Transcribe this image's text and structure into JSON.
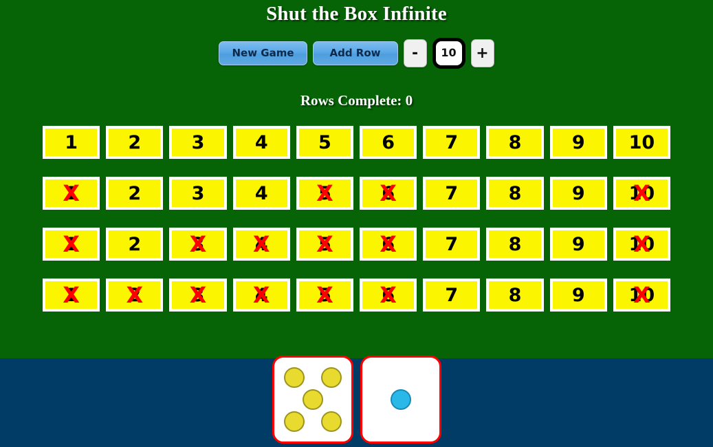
{
  "colors": {
    "board_green": "#066406",
    "tray_navy": "#003c66",
    "tile_yellow": "#fcf500",
    "tile_border": "#ffffff",
    "cross_red": "#ff0000",
    "button_blue": "#5aa8e8",
    "die_border_red": "#ff0000",
    "pip_yellow": "#e8da2e",
    "pip_cyan": "#2ab8e8"
  },
  "header": {
    "title": "Shut the Box Infinite"
  },
  "controls": {
    "new_game_label": "New Game",
    "add_row_label": "Add Row",
    "decrement_label": "-",
    "increment_label": "+",
    "row_count_value": "10"
  },
  "status": {
    "rows_complete_text": "Rows Complete: 0",
    "rows_complete_count": 0
  },
  "board": {
    "cross_glyph": "X",
    "columns": 10,
    "rows": [
      {
        "index": 1,
        "tiles": [
          {
            "label": "1",
            "open": true
          },
          {
            "label": "2",
            "open": true
          },
          {
            "label": "3",
            "open": true
          },
          {
            "label": "4",
            "open": true
          },
          {
            "label": "5",
            "open": true
          },
          {
            "label": "6",
            "open": true
          },
          {
            "label": "7",
            "open": true
          },
          {
            "label": "8",
            "open": true
          },
          {
            "label": "9",
            "open": true
          },
          {
            "label": "10",
            "open": true
          }
        ]
      },
      {
        "index": 2,
        "tiles": [
          {
            "label": "1",
            "open": false
          },
          {
            "label": "2",
            "open": true
          },
          {
            "label": "3",
            "open": true
          },
          {
            "label": "4",
            "open": true
          },
          {
            "label": "5",
            "open": false
          },
          {
            "label": "6",
            "open": false
          },
          {
            "label": "7",
            "open": true
          },
          {
            "label": "8",
            "open": true
          },
          {
            "label": "9",
            "open": true
          },
          {
            "label": "10",
            "open": false
          }
        ]
      },
      {
        "index": 3,
        "tiles": [
          {
            "label": "1",
            "open": false
          },
          {
            "label": "2",
            "open": true
          },
          {
            "label": "3",
            "open": false
          },
          {
            "label": "4",
            "open": false
          },
          {
            "label": "5",
            "open": false
          },
          {
            "label": "6",
            "open": false
          },
          {
            "label": "7",
            "open": true
          },
          {
            "label": "8",
            "open": true
          },
          {
            "label": "9",
            "open": true
          },
          {
            "label": "10",
            "open": false
          }
        ]
      },
      {
        "index": 4,
        "tiles": [
          {
            "label": "1",
            "open": false
          },
          {
            "label": "2",
            "open": false
          },
          {
            "label": "3",
            "open": false
          },
          {
            "label": "4",
            "open": false
          },
          {
            "label": "5",
            "open": false
          },
          {
            "label": "6",
            "open": false
          },
          {
            "label": "7",
            "open": true
          },
          {
            "label": "8",
            "open": true
          },
          {
            "label": "9",
            "open": true
          },
          {
            "label": "10",
            "open": false
          }
        ]
      }
    ]
  },
  "dice": [
    {
      "name": "die-one",
      "value": 5,
      "pip_color": "yellow"
    },
    {
      "name": "die-two",
      "value": 1,
      "pip_color": "cyan"
    }
  ]
}
